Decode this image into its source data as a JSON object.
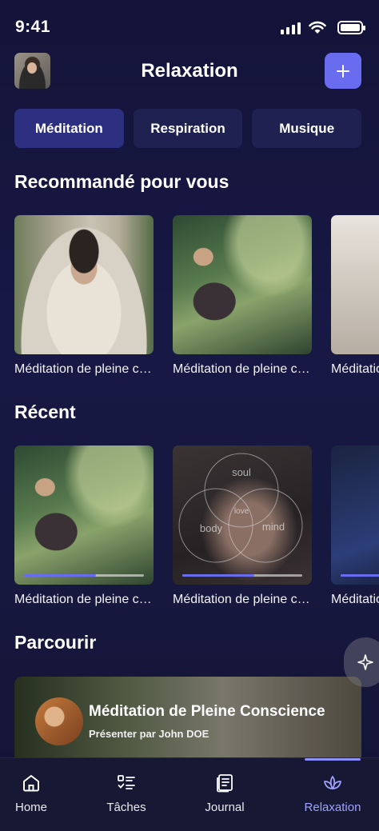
{
  "status": {
    "time": "9:41"
  },
  "header": {
    "title": "Relaxation",
    "add_icon": "plus-icon"
  },
  "tabs": [
    {
      "label": "Méditation",
      "active": true
    },
    {
      "label": "Respiration",
      "active": false
    },
    {
      "label": "Musique",
      "active": false
    }
  ],
  "recommended": {
    "title": "Recommandé pour vous",
    "items": [
      {
        "label": "Méditation de  pleine conscience"
      },
      {
        "label": "Méditation de  pleine conscience"
      },
      {
        "label": "Méditation de  pleine conscience"
      }
    ]
  },
  "recent": {
    "title": "Récent",
    "items": [
      {
        "label": "Méditation de  pleine conscience",
        "progress": 0.6
      },
      {
        "label": "Méditation de  pleine conscience",
        "progress": 0.6
      },
      {
        "label": "Méditation de  pleine conscience",
        "progress": 0.6
      }
    ],
    "soul_words": [
      "soul",
      "body",
      "mind",
      "love"
    ]
  },
  "browse": {
    "title": "Parcourir",
    "card_title": "Méditation de Pleine Conscience",
    "card_subtitle": "Présenter par John DOE"
  },
  "tabbar": [
    {
      "label": "Home",
      "icon": "home-icon"
    },
    {
      "label": "Tâches",
      "icon": "tasks-icon"
    },
    {
      "label": "Journal",
      "icon": "journal-icon"
    },
    {
      "label": "Relaxation",
      "icon": "lotus-icon",
      "active": true
    }
  ],
  "colors": {
    "accent": "#6a6cf0",
    "background": "#15163c",
    "active_tab_label": "#9ea1ff"
  }
}
